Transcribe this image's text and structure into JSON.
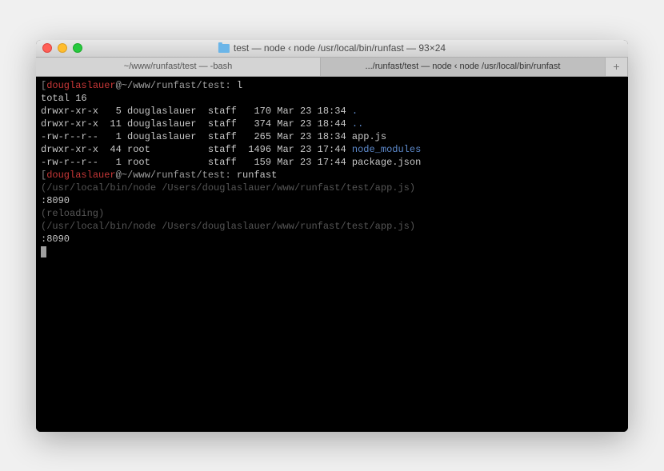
{
  "window": {
    "title": "test — node ‹ node /usr/local/bin/runfast — 93×24"
  },
  "tabs": {
    "tab1": "~/www/runfast/test — -bash",
    "tab2": ".../runfast/test — node ‹ node /usr/local/bin/runfast",
    "add": "+"
  },
  "prompt1": {
    "lb": "[",
    "user": "douglaslauer",
    "at": "@~/www/runfast/test: ",
    "cmd": "l"
  },
  "ls": {
    "total": "total 16",
    "r1": "drwxr-xr-x   5 douglaslauer  staff   170 Mar 23 18:34 ",
    "r1n": ".",
    "r2": "drwxr-xr-x  11 douglaslauer  staff   374 Mar 23 18:44 ",
    "r2n": "..",
    "r3": "-rw-r--r--   1 douglaslauer  staff   265 Mar 23 18:34 app.js",
    "r4": "drwxr-xr-x  44 root          staff  1496 Mar 23 17:44 ",
    "r4n": "node_modules",
    "r5": "-rw-r--r--   1 root          staff   159 Mar 23 17:44 package.json"
  },
  "prompt2": {
    "lb": "[",
    "user": "douglaslauer",
    "at": "@~/www/runfast/test: ",
    "cmd": "runfast"
  },
  "out": {
    "l1": "(/usr/local/bin/node /Users/douglaslauer/www/runfast/test/app.js)",
    "l2": ":8090",
    "l3": "(reloading)",
    "l4": "(/usr/local/bin/node /Users/douglaslauer/www/runfast/test/app.js)",
    "l5": ":8090"
  }
}
